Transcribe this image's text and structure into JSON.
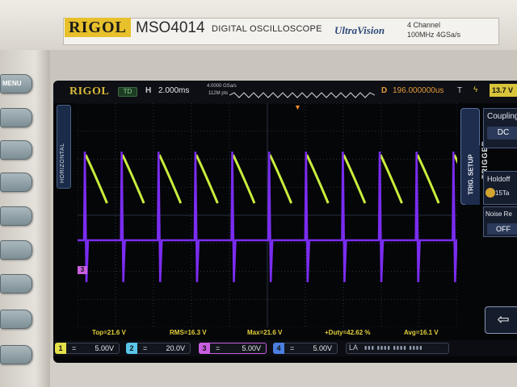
{
  "device": {
    "brand": "RIGOL",
    "model": "MSO4014",
    "model_desc": "DIGITAL OSCILLOSCOPE",
    "tech_logo": "UltraVision",
    "spec_channels": "4 Channel",
    "spec_bw": "100MHz 4GSa/s",
    "menu_button": "MENU"
  },
  "screen": {
    "logo": "RIGOL",
    "run_state": "TD",
    "timebase_label": "H",
    "timebase_value": "2.000ms",
    "sample_rate": "4.0000 GSa/s",
    "memory_depth": "112M pts",
    "delay_label": "D",
    "delay_value": "196.000000us",
    "trigger_label": "T",
    "trigger_level": "13.7 V",
    "horizontal_tab": "HORIZONTAL",
    "ch3_marker": "3"
  },
  "trigger_menu": {
    "tab_label": "TRIGGER",
    "setup_label": "TRIG. SETUP",
    "coupling_title": "Coupling",
    "coupling_value": "DC",
    "holdoff_title": "Holdoff",
    "holdoff_value": "15Ta",
    "noise_title": "Noise Re",
    "noise_value": "OFF",
    "back_glyph": "⇦"
  },
  "measurements": {
    "top": "Top=21.6 V",
    "rms": "RMS=16.3 V",
    "max": "Max=21.6 V",
    "duty": "+Duty=42.62 %",
    "avg": "Avg=16.1 V"
  },
  "channels": [
    {
      "num": "1",
      "eq": "=",
      "scale": "5.00V",
      "color": "#e3e04a"
    },
    {
      "num": "2",
      "eq": "=",
      "scale": "20.0V",
      "color": "#5bc6e8"
    },
    {
      "num": "3",
      "eq": "=",
      "scale": "5.00V",
      "color": "#c95fe0"
    },
    {
      "num": "4",
      "eq": "=",
      "scale": "5.00V",
      "color": "#4b7fe0"
    }
  ],
  "logic_analyzer": {
    "label": "LA",
    "cells": "▮▮▮ ▮▮▮▮ ▮▮▮▮ ▮▮▮▮",
    "nums": "16 11 7 3"
  },
  "colors": {
    "ch1_trace": "#c9ee3c",
    "ch3_trace": "#7a2cf0",
    "grid": "#3a4458",
    "accent_trigger": "#e39a3c"
  }
}
